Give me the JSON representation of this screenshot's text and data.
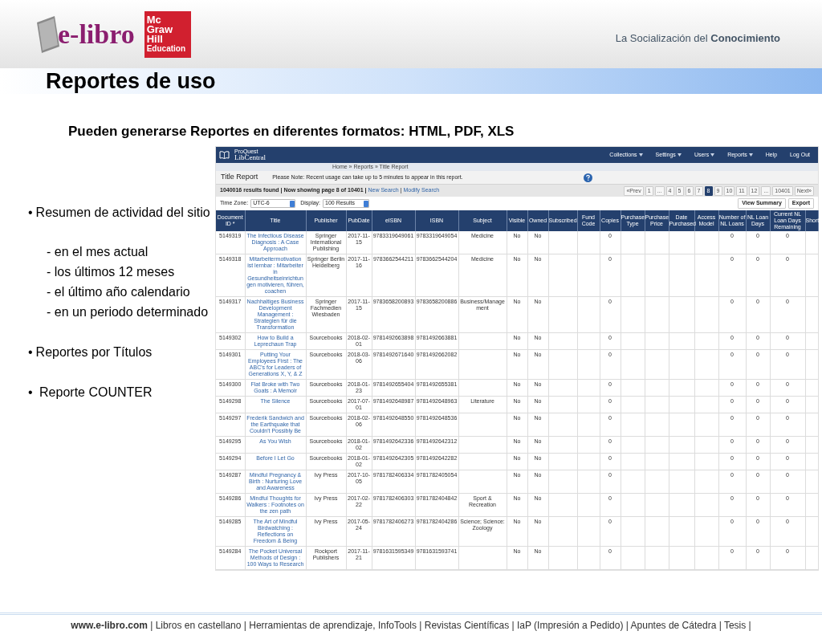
{
  "header": {
    "logo_text": "e-libro",
    "publisher_logo": [
      "Mc",
      "Graw",
      "Hill",
      "Education"
    ],
    "tagline": "La Socialización del **Conocimiento**"
  },
  "title": "Reportes de uso",
  "subtitle": "Pueden generarse Reportes en diferentes formatos:  HTML, PDF, XLS",
  "bullets": [
    {
      "marker": "•",
      "text": "Resumen de actividad del sitio",
      "children": [
        "- en el mes actual",
        "- los últimos 12 meses",
        "- el último año calendario",
        "- en un periodo determinado"
      ]
    },
    {
      "marker": "•",
      "text": "Reportes por Títulos"
    },
    {
      "marker": "•",
      "text": " Reporte COUNTER"
    }
  ],
  "libcentral": {
    "brand_small": "ProQuest",
    "brand": "LibCentral",
    "nav": [
      {
        "label": "Collections",
        "dropdown": true
      },
      {
        "label": "Settings",
        "dropdown": true
      },
      {
        "label": "Users",
        "dropdown": true
      },
      {
        "label": "Reports",
        "dropdown": true
      },
      {
        "label": "Help",
        "dropdown": false
      },
      {
        "label": "Log Out",
        "dropdown": false
      }
    ],
    "breadcrumb": "Home » Reports » Title Report",
    "page_title": "Title Report",
    "notice": "Please Note: Recent usage can take up to 5 minutes to appear in this report.",
    "results_summary": "1040016 results found | Now showing page 8 of 10401 |",
    "links": [
      "New Search",
      "Modify Search"
    ],
    "link_separator": "|",
    "pages": [
      {
        "label": "«Prev",
        "selected": false
      },
      {
        "label": "1",
        "selected": false
      },
      {
        "label": "...",
        "selected": false
      },
      {
        "label": "4",
        "selected": false
      },
      {
        "label": "5",
        "selected": false
      },
      {
        "label": "6",
        "selected": false
      },
      {
        "label": "7",
        "selected": false
      },
      {
        "label": "8",
        "selected": true
      },
      {
        "label": "9",
        "selected": false
      },
      {
        "label": "10",
        "selected": false
      },
      {
        "label": "11",
        "selected": false
      },
      {
        "label": "12",
        "selected": false
      },
      {
        "label": "...",
        "selected": false
      },
      {
        "label": "10401",
        "selected": false
      },
      {
        "label": "Next»",
        "selected": false
      }
    ],
    "filters": [
      {
        "label": "Time Zone:",
        "value": "UTC-6"
      },
      {
        "label": "Display:",
        "value": "100 Results"
      }
    ],
    "buttons": [
      "View Summary",
      "Export"
    ],
    "table": {
      "columns": [
        {
          "label": "Document ID *",
          "kind": "text"
        },
        {
          "label": "Title",
          "kind": "link"
        },
        {
          "label": "Publisher",
          "kind": "text"
        },
        {
          "label": "PubDate",
          "kind": "text"
        },
        {
          "label": "eISBN",
          "kind": "text"
        },
        {
          "label": "ISBN",
          "kind": "text"
        },
        {
          "label": "Subject",
          "kind": "text"
        },
        {
          "label": "Visible",
          "kind": "text"
        },
        {
          "label": "Owned",
          "kind": "text"
        },
        {
          "label": "Subscribed",
          "kind": "text"
        },
        {
          "label": "Fund Code",
          "kind": "text"
        },
        {
          "label": "Copies",
          "kind": "text"
        },
        {
          "label": "Purchase Type",
          "kind": "text"
        },
        {
          "label": "Purchase Price",
          "kind": "text"
        },
        {
          "label": "Date Purchased",
          "kind": "text"
        },
        {
          "label": "Access Model",
          "kind": "text"
        },
        {
          "label": "Number of NL Loans",
          "kind": "text"
        },
        {
          "label": "NL Loan Days",
          "kind": "text"
        },
        {
          "label": "Current NL Loan Days Remaining",
          "kind": "text"
        },
        {
          "label": "Short",
          "kind": "text"
        }
      ],
      "rows": [
        [
          "5149319",
          "The Infectious Disease Diagnosis : A Case Approach",
          "Springer International Publishing",
          "2017-11-15",
          "9783319649061",
          "9783319649054",
          "Medicine",
          "No",
          "No",
          null,
          null,
          "0",
          null,
          null,
          null,
          null,
          "0",
          "0",
          "0",
          null
        ],
        [
          "5149318",
          "Mitarbeitermotivation ist lernbar : Mitarbeiter in Gesundheitseinrichtungen motivieren, führen, coachen",
          "Springer Berlin Heidelberg",
          "2017-11-16",
          "9783662544211",
          "9783662544204",
          "Medicine",
          "No",
          "No",
          null,
          null,
          "0",
          null,
          null,
          null,
          null,
          "0",
          "0",
          "0",
          null
        ],
        [
          "5149317",
          "Nachhaltiges Business Development Management : Strategien für die Transformation",
          "Springer Fachmedien Wiesbaden",
          "2017-11-15",
          "9783658200893",
          "9783658200886",
          "Business/Management",
          "No",
          "No",
          null,
          null,
          "0",
          null,
          null,
          null,
          null,
          "0",
          "0",
          "0",
          null
        ],
        [
          "5149302",
          "How to Build a Leprechaun Trap",
          "Sourcebooks",
          "2018-02-01",
          "9781492663898",
          "9781492663881",
          null,
          "No",
          "No",
          null,
          null,
          "0",
          null,
          null,
          null,
          null,
          "0",
          "0",
          "0",
          null
        ],
        [
          "5149301",
          "Putting Your Employees First : The ABC's for Leaders of Generations X, Y, & Z",
          "Sourcebooks",
          "2018-03-06",
          "9781492671640",
          "9781492662082",
          null,
          "No",
          "No",
          null,
          null,
          "0",
          null,
          null,
          null,
          null,
          "0",
          "0",
          "0",
          null
        ],
        [
          "5149300",
          "Flat Broke with Two Goats : A Memoir",
          "Sourcebooks",
          "2018-01-23",
          "9781492655404",
          "9781492655381",
          null,
          "No",
          "No",
          null,
          null,
          "0",
          null,
          null,
          null,
          null,
          "0",
          "0",
          "0",
          null
        ],
        [
          "5149298",
          "The Silence",
          "Sourcebooks",
          "2017-07-01",
          "9781492648987",
          "9781492648963",
          "Literature",
          "No",
          "No",
          null,
          null,
          "0",
          null,
          null,
          null,
          null,
          "0",
          "0",
          "0",
          null
        ],
        [
          "5149297",
          "Frederik Sandwich and the Earthquake that Couldn't Possibly Be",
          "Sourcebooks",
          "2018-02-06",
          "9781492648550",
          "9781492648536",
          null,
          "No",
          "No",
          null,
          null,
          "0",
          null,
          null,
          null,
          null,
          "0",
          "0",
          "0",
          null
        ],
        [
          "5149295",
          "As You Wish",
          "Sourcebooks",
          "2018-01-02",
          "9781492642336",
          "9781492642312",
          null,
          "No",
          "No",
          null,
          null,
          "0",
          null,
          null,
          null,
          null,
          "0",
          "0",
          "0",
          null
        ],
        [
          "5149294",
          "Before I Let Go",
          "Sourcebooks",
          "2018-01-02",
          "9781492642305",
          "9781492642282",
          null,
          "No",
          "No",
          null,
          null,
          "0",
          null,
          null,
          null,
          null,
          "0",
          "0",
          "0",
          null
        ],
        [
          "5149287",
          "Mindful Pregnancy & Birth : Nurturing Love and Awareness",
          "Ivy Press",
          "2017-10-05",
          "9781782406334",
          "9781782405054",
          null,
          "No",
          "No",
          null,
          null,
          "0",
          null,
          null,
          null,
          null,
          "0",
          "0",
          "0",
          null
        ],
        [
          "5149286",
          "Mindful Thoughts for Walkers : Footnotes on the zen path",
          "Ivy Press",
          "2017-02-22",
          "9781782406303",
          "9781782404842",
          "Sport & Recreation",
          "No",
          "No",
          null,
          null,
          "0",
          null,
          null,
          null,
          null,
          "0",
          "0",
          "0",
          null
        ],
        [
          "5149285",
          "The Art of Mindful Birdwatching : Reflections on Freedom & Being",
          "Ivy Press",
          "2017-05-24",
          "9781782406273",
          "9781782404286",
          "Science; Science: Zoology",
          "No",
          "No",
          null,
          null,
          "0",
          null,
          null,
          null,
          null,
          "0",
          "0",
          "0",
          null
        ],
        [
          "5149284",
          "The Pocket Universal Methods of Design : 100 Ways to Research",
          "Rockport Publishers",
          "2017-11-21",
          "9781631595349",
          "9781631593741",
          null,
          "No",
          "No",
          null,
          null,
          "0",
          null,
          null,
          null,
          null,
          "0",
          "0",
          "0",
          null
        ]
      ]
    }
  },
  "footer": "**www.e-libro.com** | Libros en castellano | Herramientas de aprendizaje, InfoTools | Revistas Científicas | IaP (Impresión a Pedido) | Apuntes de Cátedra | Tesis |"
}
